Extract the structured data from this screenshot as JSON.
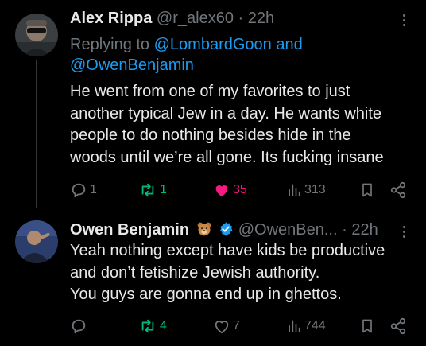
{
  "tweets": [
    {
      "author": "Alex Rippa",
      "handle": "@r_alex60",
      "separator": "·",
      "time": "22h",
      "reply_prefix": "Replying to",
      "reply_users": [
        "@LombardGoon",
        "@OwenBenjamin"
      ],
      "reply_joiner": "and",
      "lines": [
        "He went from one of my favorites to just",
        "another typical Jew in a day. He wants white",
        "people to do nothing besides hide in the",
        "woods until we’re all gone. Its fucking insane"
      ],
      "stats": {
        "replies": "1",
        "reposts": "1",
        "likes": "35",
        "views": "313"
      },
      "liked": true
    },
    {
      "author": "Owen Benjamin",
      "handle": "@OwenBen...",
      "separator": "·",
      "time": "22h",
      "lines": [
        "Yeah nothing except have kids be productive",
        "and don’t fetishize Jewish authority.",
        "You guys are gonna end up in ghettos."
      ],
      "stats": {
        "replies": "",
        "reposts": "4",
        "likes": "7",
        "views": "744"
      },
      "liked": false
    }
  ],
  "colors": {
    "text": "#e7e9ea",
    "muted": "#71767b",
    "link": "#1d9bf0",
    "like": "#f91880",
    "repost": "#00ba7c"
  },
  "icons": [
    "reply-icon",
    "repost-icon",
    "like-icon",
    "views-icon",
    "bookmark-icon",
    "share-icon",
    "more-icon",
    "bear-emoji-icon",
    "verified-badge-icon"
  ]
}
